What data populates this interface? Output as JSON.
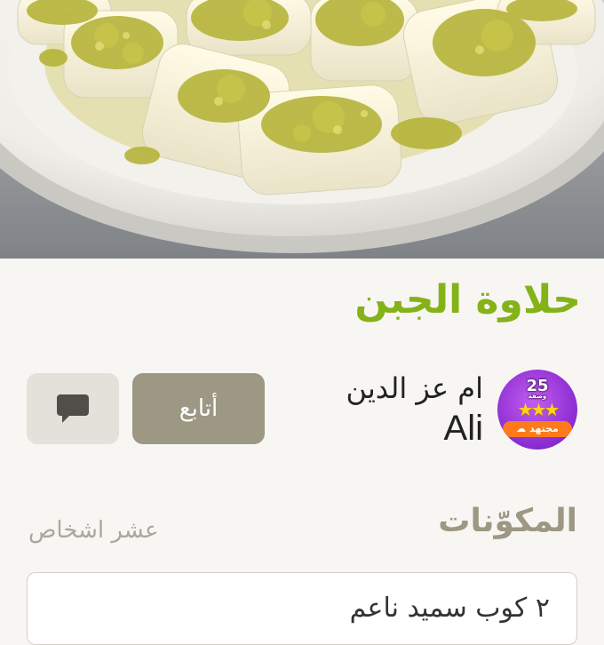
{
  "recipe": {
    "title": "حلاوة الجبن",
    "photo_alt": "recipe-photo"
  },
  "author": {
    "name": "ام عز الدين",
    "handle": "Ali",
    "badge": {
      "count": "25",
      "count_caption": "وصفة",
      "rank": "مجتهد"
    }
  },
  "actions": {
    "follow_label": "أتابع",
    "comment_icon": "comment-icon"
  },
  "ingredients": {
    "title": "المكوّنات",
    "servings": "عشر اشخاص",
    "first_item": "٢ كوب سميد ناعم"
  },
  "colors": {
    "title": "#84b219",
    "follow_button": "#9c9883",
    "comment_button": "#e3e2da",
    "badge": "#8a2bd0"
  }
}
